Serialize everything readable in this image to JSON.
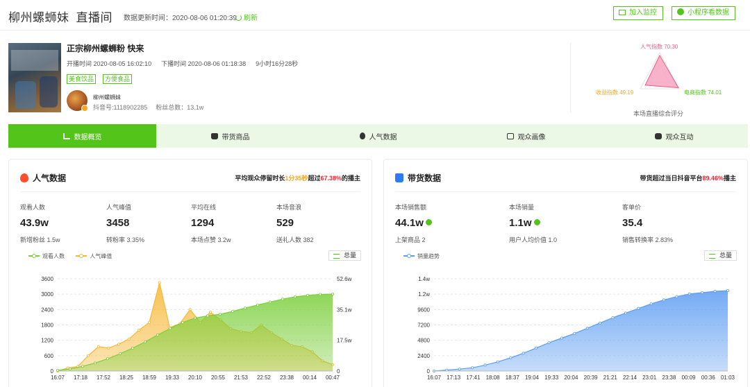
{
  "header": {
    "title": "柳州螺蛳妹",
    "subtitle": "直播间",
    "update_label": "数据更新时间：2020-08-06 01:20:39",
    "refresh_label": "刷新",
    "monitor_button": "加入监控",
    "mini_program_button": "小程序看数据"
  },
  "live": {
    "title": "正宗柳州螺蛳粉 快来",
    "start_time": "开播时间 2020-08-05 16:02:10",
    "end_time": "下播时间 2020-08-06 01:18:38",
    "duration": "9小时16分28秒",
    "tags": [
      "美食饮品",
      "方便食品"
    ],
    "account_name": "柳州螺蛳妹",
    "douyin_id": "抖音号:1118902285",
    "fans_total": "粉丝总数：13.1w"
  },
  "score": {
    "popularity_label": "人气指数 70.30",
    "revenue_label": "收益指数 49.19",
    "ecommerce_label": "电商指数 74.01",
    "popularity": 70.3,
    "revenue": 49.19,
    "ecommerce": 74.01,
    "caption": "本场直播综合评分",
    "color": "#f25b8a"
  },
  "tabs": [
    {
      "label": "数据概览",
      "icon": "bar-chart-icon"
    },
    {
      "label": "带货商品",
      "icon": "shopping-bag-icon"
    },
    {
      "label": "人气数据",
      "icon": "fire-icon"
    },
    {
      "label": "观众画像",
      "icon": "user-scan-icon"
    },
    {
      "label": "观众互动",
      "icon": "chat-icon"
    }
  ],
  "popularity_panel": {
    "title": "人气数据",
    "summary_prefix": "平均观众停留时长",
    "summary_time": "1分35秒",
    "summary_mid": "超过",
    "summary_pct": "67.38%",
    "summary_suffix": "的播主",
    "stats": [
      {
        "label": "观看人数",
        "value": "43.9w",
        "sub": "新增粉丝 1.5w"
      },
      {
        "label": "人气峰值",
        "value": "3458",
        "sub": "转粉率 3.35%"
      },
      {
        "label": "平均在线",
        "value": "1294",
        "sub": "本场点赞 3.2w"
      },
      {
        "label": "本场音浪",
        "value": "529",
        "sub": "送礼人数 382"
      }
    ],
    "legend_viewers": "观看人数",
    "legend_peak": "人气峰值",
    "total_button": "总量"
  },
  "sales_panel": {
    "title": "带货数据",
    "summary_prefix": "带货超过当日抖音平台",
    "summary_pct": "89.46%",
    "summary_suffix": "播主",
    "stats": [
      {
        "label": "本场销售额",
        "value": "44.1w",
        "sub": "上架商品 2"
      },
      {
        "label": "本场销量",
        "value": "1.1w",
        "sub": "用户人均价值 1.0"
      },
      {
        "label": "客单价",
        "value": "35.4",
        "sub": "销售转换率 2.83%"
      }
    ],
    "legend_sales": "销量趋势",
    "total_button": "总量"
  },
  "chart_data": [
    {
      "type": "area",
      "x": [
        "16:07",
        "17:18",
        "17:52",
        "18:25",
        "18:59",
        "19:33",
        "20:10",
        "20:55",
        "21:53",
        "22:52",
        "23:38",
        "00:14",
        "00:47"
      ],
      "yticks_left": [
        "3600",
        "3000",
        "2400",
        "1800",
        "1200",
        "600",
        "0"
      ],
      "yticks_right": [
        "52.6w",
        "35.1w",
        "17.5w",
        "0"
      ],
      "ylim_left": [
        0,
        3600
      ],
      "ylim_right": [
        0,
        526000
      ],
      "grid": true,
      "series": [
        {
          "name": "观看人数",
          "axis": "right",
          "color": "#7ccf3c",
          "values": [
            4000,
            12000,
            27000,
            46000,
            70000,
            99000,
            131000,
            166000,
            206000,
            243000,
            277000,
            302000,
            315000,
            324000,
            340000,
            359000,
            377000,
            394000,
            410000,
            423000,
            432000,
            437000,
            439000
          ]
        },
        {
          "name": "人气峰值",
          "axis": "left",
          "color": "#f7b733",
          "values": [
            0,
            120,
            180,
            600,
            950,
            900,
            1050,
            1250,
            1600,
            1900,
            3450,
            1700,
            1850,
            2400,
            1900,
            2300,
            2000,
            1650,
            1550,
            1500,
            1800,
            1500,
            1250,
            1000,
            950,
            750,
            400,
            250
          ]
        }
      ]
    },
    {
      "type": "area",
      "x": [
        "16:07",
        "17:13",
        "17:41",
        "18:08",
        "18:37",
        "19:04",
        "19:33",
        "20:04",
        "20:39",
        "21:21",
        "22:14",
        "23:01",
        "23:38",
        "00:09",
        "00:36",
        "01:03"
      ],
      "yticks": [
        "1.4w",
        "1.2w",
        "9600",
        "7200",
        "4800",
        "2400",
        "0"
      ],
      "ylim": [
        0,
        14000
      ],
      "grid": true,
      "series": [
        {
          "name": "销量趋势",
          "color": "#5b9cf2",
          "values": [
            0,
            150,
            300,
            500,
            900,
            1400,
            2000,
            2700,
            3500,
            4300,
            5000,
            5700,
            6500,
            7300,
            8100,
            8800,
            9500,
            10200,
            10800,
            11300,
            11700,
            11900,
            12100,
            12200
          ]
        }
      ]
    }
  ]
}
